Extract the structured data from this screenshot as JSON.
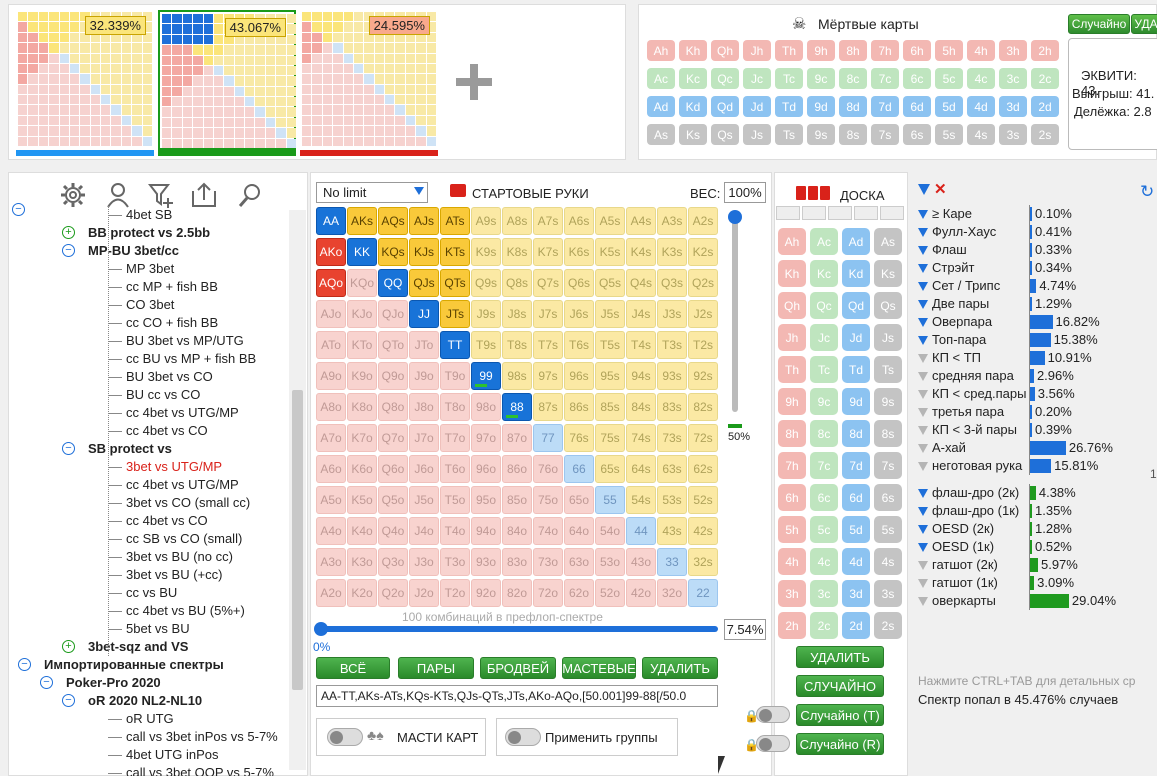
{
  "ranges": [
    {
      "pct": "32.339%",
      "pct_bg": "#fbe57a",
      "bar_color": "#2196f3",
      "border": "#ffffff"
    },
    {
      "pct": "43.067%",
      "pct_bg": "#fbe57a",
      "bar_color": "#1a9a1a",
      "border": "#1a9a1a"
    },
    {
      "pct": "24.595%",
      "pct_bg": "#f9a98c",
      "bar_color": "#d9221a",
      "border": "#ffffff"
    }
  ],
  "dead": {
    "title": "Мёртвые карты",
    "rows": [
      [
        "Ah",
        "Kh",
        "Qh",
        "Jh",
        "Th",
        "9h",
        "8h",
        "7h",
        "6h",
        "5h",
        "4h",
        "3h",
        "2h"
      ],
      [
        "Ac",
        "Kc",
        "Qc",
        "Jc",
        "Tc",
        "9c",
        "8c",
        "7c",
        "6c",
        "5c",
        "4c",
        "3c",
        "2c"
      ],
      [
        "Ad",
        "Kd",
        "Qd",
        "Jd",
        "Td",
        "9d",
        "8d",
        "7d",
        "6d",
        "5d",
        "4d",
        "3d",
        "2d"
      ],
      [
        "As",
        "Ks",
        "Qs",
        "Js",
        "Ts",
        "9s",
        "8s",
        "7s",
        "6s",
        "5s",
        "4s",
        "3s",
        "2s"
      ]
    ],
    "random_btn": "Случайно",
    "delete_btn": "УДА",
    "equity": "ЭКВИТИ: 43.",
    "wins": "Выигрыш: 41.",
    "split": "Делёжка: 2.8"
  },
  "tree": [
    {
      "t": "4bet SB",
      "l": 3,
      "c": ""
    },
    {
      "t": "BB protect vs 2.5bb",
      "l": 2,
      "c": "bold",
      "tog": "+"
    },
    {
      "t": "MP-BU 3bet/cc",
      "l": 2,
      "c": "bold",
      "tog": "-"
    },
    {
      "t": "MP 3bet",
      "l": 3,
      "c": ""
    },
    {
      "t": "cc MP + fish BB",
      "l": 3,
      "c": ""
    },
    {
      "t": "CO 3bet",
      "l": 3,
      "c": ""
    },
    {
      "t": "cc CO + fish BB",
      "l": 3,
      "c": ""
    },
    {
      "t": "BU 3bet vs MP/UTG",
      "l": 3,
      "c": ""
    },
    {
      "t": "cc BU vs MP + fish BB",
      "l": 3,
      "c": ""
    },
    {
      "t": "BU 3bet vs CO",
      "l": 3,
      "c": ""
    },
    {
      "t": "BU cc vs CO",
      "l": 3,
      "c": ""
    },
    {
      "t": "cc 4bet vs UTG/MP",
      "l": 3,
      "c": ""
    },
    {
      "t": "cc 4bet vs CO",
      "l": 3,
      "c": ""
    },
    {
      "t": "SB protect vs",
      "l": 2,
      "c": "bold",
      "tog": "-"
    },
    {
      "t": "3bet vs UTG/MP",
      "l": 3,
      "c": "red"
    },
    {
      "t": "cc 4bet vs UTG/MP",
      "l": 3,
      "c": ""
    },
    {
      "t": "3bet vs CO (small cc)",
      "l": 3,
      "c": ""
    },
    {
      "t": "cc 4bet vs CO",
      "l": 3,
      "c": ""
    },
    {
      "t": "cc SB vs CO (small)",
      "l": 3,
      "c": ""
    },
    {
      "t": "3bet vs BU (no cc)",
      "l": 3,
      "c": ""
    },
    {
      "t": "3bet vs BU (+cc)",
      "l": 3,
      "c": ""
    },
    {
      "t": "cc vs BU",
      "l": 3,
      "c": ""
    },
    {
      "t": "cc 4bet vs BU (5%+)",
      "l": 3,
      "c": ""
    },
    {
      "t": "5bet vs BU",
      "l": 3,
      "c": ""
    },
    {
      "t": "3bet-sqz and VS",
      "l": 2,
      "c": "bold",
      "tog": "+"
    },
    {
      "t": "Импортированные спектры",
      "l": 0,
      "c": "bold",
      "tog": "-"
    },
    {
      "t": "Poker-Pro 2020",
      "l": 1,
      "c": "bold",
      "tog": "-"
    },
    {
      "t": "oR 2020 NL2-NL10",
      "l": 2,
      "c": "bold",
      "tog": "-"
    },
    {
      "t": "oR UTG",
      "l": 3,
      "c": ""
    },
    {
      "t": "call vs 3bet inPos vs 5-7%",
      "l": 3,
      "c": ""
    },
    {
      "t": "4bet UTG inPos",
      "l": 3,
      "c": ""
    },
    {
      "t": "call vs 3bet OOP vs 5-7%",
      "l": 3,
      "c": ""
    }
  ],
  "editor": {
    "game": "No limit",
    "title": "СТАРТОВЫЕ РУКИ",
    "weight_label": "ВЕС:",
    "weight": "100%",
    "combos": "100 комбинаций в префлоп-спектре",
    "slider_pct": "7.54%",
    "slider_min": "0%",
    "vslider": "50%",
    "btn_all": "ВСЁ",
    "btn_pairs": "ПАРЫ",
    "btn_broadway": "БРОДВЕЙ",
    "btn_suited": "МАСТЕВЫЕ",
    "btn_delete": "УДАЛИТЬ",
    "range_text": "AA-TT,AKs-ATs,KQs-KTs,QJs-QTs,JTs,AKo-AQo,[50.001]99-88[/50.0",
    "suits_label": "МАСТИ КАРТ",
    "groups_label": "Применить группы"
  },
  "board": {
    "title": "ДОСКА",
    "rows": [
      [
        "Ah",
        "Ac",
        "Ad",
        "As"
      ],
      [
        "Kh",
        "Kc",
        "Kd",
        "Ks"
      ],
      [
        "Qh",
        "Qc",
        "Qd",
        "Qs"
      ],
      [
        "Jh",
        "Jc",
        "Jd",
        "Js"
      ],
      [
        "Th",
        "Tc",
        "Td",
        "Ts"
      ],
      [
        "9h",
        "9c",
        "9d",
        "9s"
      ],
      [
        "8h",
        "8c",
        "8d",
        "8s"
      ],
      [
        "7h",
        "7c",
        "7d",
        "7s"
      ],
      [
        "6h",
        "6c",
        "6d",
        "6s"
      ],
      [
        "5h",
        "5c",
        "5d",
        "5s"
      ],
      [
        "4h",
        "4c",
        "4d",
        "4s"
      ],
      [
        "3h",
        "3c",
        "3d",
        "3s"
      ],
      [
        "2h",
        "2c",
        "2d",
        "2s"
      ]
    ],
    "btn_delete": "УДАЛИТЬ",
    "btn_random": "СЛУЧАЙНО",
    "btn_rand_t": "Случайно (Т)",
    "btn_rand_r": "Случайно (R)"
  },
  "stats": {
    "made": [
      {
        "n": "≥ Каре",
        "v": "0.10%",
        "f": 0.1,
        "c": "#1e6fd9",
        "a": true
      },
      {
        "n": "Фулл-Хаус",
        "v": "0.41%",
        "f": 0.41,
        "c": "#1e6fd9",
        "a": true
      },
      {
        "n": "Флаш",
        "v": "0.33%",
        "f": 0.33,
        "c": "#1e6fd9",
        "a": true
      },
      {
        "n": "Стрэйт",
        "v": "0.34%",
        "f": 0.34,
        "c": "#1e6fd9",
        "a": true
      },
      {
        "n": "Сет / Трипс",
        "v": "4.74%",
        "f": 4.74,
        "c": "#1e6fd9",
        "a": true
      },
      {
        "n": "Две пары",
        "v": "1.29%",
        "f": 1.29,
        "c": "#1e6fd9",
        "a": true
      },
      {
        "n": "Оверпара",
        "v": "16.82%",
        "f": 16.82,
        "c": "#1e6fd9",
        "a": true
      },
      {
        "n": "Топ-пара",
        "v": "15.38%",
        "f": 15.38,
        "c": "#1e6fd9",
        "a": true
      },
      {
        "n": "КП < ТП",
        "v": "10.91%",
        "f": 10.91,
        "c": "#1e6fd9",
        "a": false
      },
      {
        "n": "средняя пара",
        "v": "2.96%",
        "f": 2.96,
        "c": "#1e6fd9",
        "a": false
      },
      {
        "n": "КП < сред.пары",
        "v": "3.56%",
        "f": 3.56,
        "c": "#1e6fd9",
        "a": false
      },
      {
        "n": "третья пара",
        "v": "0.20%",
        "f": 0.2,
        "c": "#1e6fd9",
        "a": false
      },
      {
        "n": "КП < 3-й пары",
        "v": "0.39%",
        "f": 0.39,
        "c": "#1e6fd9",
        "a": false
      },
      {
        "n": "А-хай",
        "v": "26.76%",
        "f": 26.76,
        "c": "#1e6fd9",
        "a": false
      },
      {
        "n": "неготовая рука",
        "v": "15.81%",
        "f": 15.81,
        "c": "#1e6fd9",
        "a": false
      }
    ],
    "draws": [
      {
        "n": "флаш-дро (2к)",
        "v": "4.38%",
        "f": 4.38,
        "c": "#1f9a1f",
        "a": true
      },
      {
        "n": "флаш-дро (1к)",
        "v": "1.35%",
        "f": 1.35,
        "c": "#1f9a1f",
        "a": true
      },
      {
        "n": "OESD (2к)",
        "v": "1.28%",
        "f": 1.28,
        "c": "#1f9a1f",
        "a": true
      },
      {
        "n": "OESD (1к)",
        "v": "0.52%",
        "f": 0.52,
        "c": "#1f9a1f",
        "a": true
      },
      {
        "n": "гатшот (2к)",
        "v": "5.97%",
        "f": 5.97,
        "c": "#1f9a1f",
        "a": false
      },
      {
        "n": "гатшот (1к)",
        "v": "3.09%",
        "f": 3.09,
        "c": "#1f9a1f",
        "a": false
      },
      {
        "n": "оверкарты",
        "v": "29.04%",
        "f": 29.04,
        "c": "#1f9a1f",
        "a": false
      }
    ],
    "side_num": "1",
    "hint": "Нажмите CTRL+TAB для детальных ср",
    "summary": "Спектр попал в 45.476% случаев"
  },
  "hands": {
    "ranks": [
      "A",
      "K",
      "Q",
      "J",
      "T",
      "9",
      "8",
      "7",
      "6",
      "5",
      "4",
      "3",
      "2"
    ],
    "blue": [
      "AA",
      "KK",
      "QQ",
      "JJ",
      "TT",
      "AKo",
      "AQo",
      "99",
      "88"
    ],
    "pale": [
      "77",
      "66",
      "55",
      "44",
      "33",
      "22"
    ],
    "orange": [
      "AKs",
      "AQs",
      "AJs",
      "ATs",
      "KQs",
      "KJs",
      "KTs",
      "QJs",
      "QTs",
      "JTs"
    ],
    "red": [
      "AKo",
      "AQo"
    ]
  }
}
